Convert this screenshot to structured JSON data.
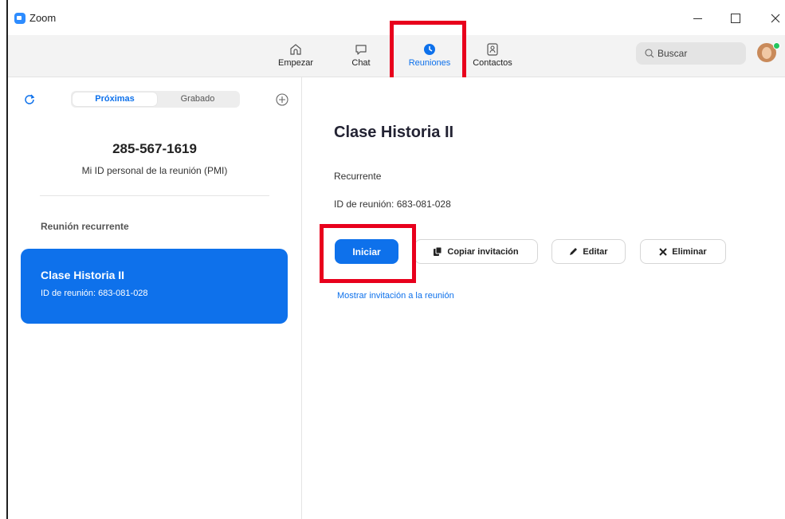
{
  "window": {
    "title": "Zoom",
    "minimize_icon": "minimize-icon",
    "maximize_icon": "maximize-icon",
    "close_icon": "close-icon"
  },
  "nav": {
    "items": [
      {
        "label": "Empezar",
        "icon": "home-icon",
        "active": false
      },
      {
        "label": "Chat",
        "icon": "chat-bubble-icon",
        "active": false
      },
      {
        "label": "Reuniones",
        "icon": "clock-icon",
        "active": true
      },
      {
        "label": "Contactos",
        "icon": "contact-card-icon",
        "active": false
      }
    ],
    "search_placeholder": "Buscar"
  },
  "sidebar": {
    "tabs": [
      "Próximas",
      "Grabado"
    ],
    "active_tab": "Próximas",
    "pmi_number": "285-567-1619",
    "pmi_label": "Mi ID personal de la reunión (PMI)",
    "section_label": "Reunión recurrente",
    "meetings": [
      {
        "title": "Clase Historia II",
        "id_line": "ID de reunión: 683-081-028",
        "selected": true
      }
    ]
  },
  "detail": {
    "title": "Clase Historia II",
    "recurrence": "Recurrente",
    "meeting_id": "ID de reunión: 683-081-028",
    "buttons": {
      "start": "Iniciar",
      "copy": "Copiar invitación",
      "edit": "Editar",
      "delete": "Eliminar"
    },
    "show_invite_link": "Mostrar invitación a la reunión"
  },
  "colors": {
    "accent": "#0e71eb",
    "highlight": "#e8001c",
    "toolbar_bg": "#f3f3f3",
    "presence": "#23c55e"
  }
}
